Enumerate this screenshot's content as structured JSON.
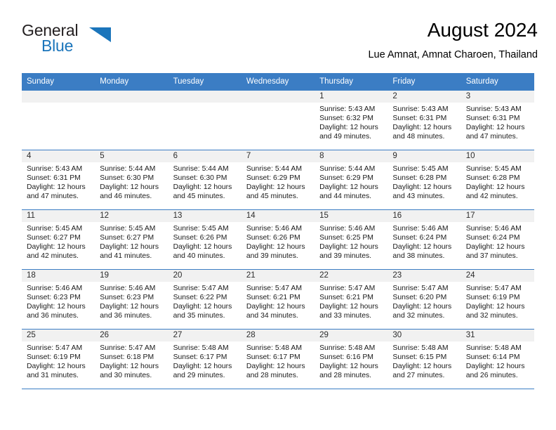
{
  "brand": {
    "word1": "General",
    "word2": "Blue",
    "triangle_color": "#1b75bb",
    "logo_icon": "triangle-flag-icon"
  },
  "header": {
    "title": "August 2024",
    "subtitle": "Lue Amnat, Amnat Charoen, Thailand"
  },
  "theme": {
    "header_blue": "#3b7dc4",
    "daynum_band": "#f1f1f1",
    "text": "#1a1a1a"
  },
  "weekdays": [
    "Sunday",
    "Monday",
    "Tuesday",
    "Wednesday",
    "Thursday",
    "Friday",
    "Saturday"
  ],
  "labels": {
    "sunrise_prefix": "Sunrise: ",
    "sunset_prefix": "Sunset: ",
    "daylight_prefix": "Daylight: "
  },
  "weeks": [
    [
      {
        "day": "",
        "empty": true
      },
      {
        "day": "",
        "empty": true
      },
      {
        "day": "",
        "empty": true
      },
      {
        "day": "",
        "empty": true
      },
      {
        "day": "1",
        "sunrise": "Sunrise: 5:43 AM",
        "sunset": "Sunset: 6:32 PM",
        "daylight1": "Daylight: 12 hours",
        "daylight2": "and 49 minutes."
      },
      {
        "day": "2",
        "sunrise": "Sunrise: 5:43 AM",
        "sunset": "Sunset: 6:31 PM",
        "daylight1": "Daylight: 12 hours",
        "daylight2": "and 48 minutes."
      },
      {
        "day": "3",
        "sunrise": "Sunrise: 5:43 AM",
        "sunset": "Sunset: 6:31 PM",
        "daylight1": "Daylight: 12 hours",
        "daylight2": "and 47 minutes."
      }
    ],
    [
      {
        "day": "4",
        "sunrise": "Sunrise: 5:43 AM",
        "sunset": "Sunset: 6:31 PM",
        "daylight1": "Daylight: 12 hours",
        "daylight2": "and 47 minutes."
      },
      {
        "day": "5",
        "sunrise": "Sunrise: 5:44 AM",
        "sunset": "Sunset: 6:30 PM",
        "daylight1": "Daylight: 12 hours",
        "daylight2": "and 46 minutes."
      },
      {
        "day": "6",
        "sunrise": "Sunrise: 5:44 AM",
        "sunset": "Sunset: 6:30 PM",
        "daylight1": "Daylight: 12 hours",
        "daylight2": "and 45 minutes."
      },
      {
        "day": "7",
        "sunrise": "Sunrise: 5:44 AM",
        "sunset": "Sunset: 6:29 PM",
        "daylight1": "Daylight: 12 hours",
        "daylight2": "and 45 minutes."
      },
      {
        "day": "8",
        "sunrise": "Sunrise: 5:44 AM",
        "sunset": "Sunset: 6:29 PM",
        "daylight1": "Daylight: 12 hours",
        "daylight2": "and 44 minutes."
      },
      {
        "day": "9",
        "sunrise": "Sunrise: 5:45 AM",
        "sunset": "Sunset: 6:28 PM",
        "daylight1": "Daylight: 12 hours",
        "daylight2": "and 43 minutes."
      },
      {
        "day": "10",
        "sunrise": "Sunrise: 5:45 AM",
        "sunset": "Sunset: 6:28 PM",
        "daylight1": "Daylight: 12 hours",
        "daylight2": "and 42 minutes."
      }
    ],
    [
      {
        "day": "11",
        "sunrise": "Sunrise: 5:45 AM",
        "sunset": "Sunset: 6:27 PM",
        "daylight1": "Daylight: 12 hours",
        "daylight2": "and 42 minutes."
      },
      {
        "day": "12",
        "sunrise": "Sunrise: 5:45 AM",
        "sunset": "Sunset: 6:27 PM",
        "daylight1": "Daylight: 12 hours",
        "daylight2": "and 41 minutes."
      },
      {
        "day": "13",
        "sunrise": "Sunrise: 5:45 AM",
        "sunset": "Sunset: 6:26 PM",
        "daylight1": "Daylight: 12 hours",
        "daylight2": "and 40 minutes."
      },
      {
        "day": "14",
        "sunrise": "Sunrise: 5:46 AM",
        "sunset": "Sunset: 6:26 PM",
        "daylight1": "Daylight: 12 hours",
        "daylight2": "and 39 minutes."
      },
      {
        "day": "15",
        "sunrise": "Sunrise: 5:46 AM",
        "sunset": "Sunset: 6:25 PM",
        "daylight1": "Daylight: 12 hours",
        "daylight2": "and 39 minutes."
      },
      {
        "day": "16",
        "sunrise": "Sunrise: 5:46 AM",
        "sunset": "Sunset: 6:24 PM",
        "daylight1": "Daylight: 12 hours",
        "daylight2": "and 38 minutes."
      },
      {
        "day": "17",
        "sunrise": "Sunrise: 5:46 AM",
        "sunset": "Sunset: 6:24 PM",
        "daylight1": "Daylight: 12 hours",
        "daylight2": "and 37 minutes."
      }
    ],
    [
      {
        "day": "18",
        "sunrise": "Sunrise: 5:46 AM",
        "sunset": "Sunset: 6:23 PM",
        "daylight1": "Daylight: 12 hours",
        "daylight2": "and 36 minutes."
      },
      {
        "day": "19",
        "sunrise": "Sunrise: 5:46 AM",
        "sunset": "Sunset: 6:23 PM",
        "daylight1": "Daylight: 12 hours",
        "daylight2": "and 36 minutes."
      },
      {
        "day": "20",
        "sunrise": "Sunrise: 5:47 AM",
        "sunset": "Sunset: 6:22 PM",
        "daylight1": "Daylight: 12 hours",
        "daylight2": "and 35 minutes."
      },
      {
        "day": "21",
        "sunrise": "Sunrise: 5:47 AM",
        "sunset": "Sunset: 6:21 PM",
        "daylight1": "Daylight: 12 hours",
        "daylight2": "and 34 minutes."
      },
      {
        "day": "22",
        "sunrise": "Sunrise: 5:47 AM",
        "sunset": "Sunset: 6:21 PM",
        "daylight1": "Daylight: 12 hours",
        "daylight2": "and 33 minutes."
      },
      {
        "day": "23",
        "sunrise": "Sunrise: 5:47 AM",
        "sunset": "Sunset: 6:20 PM",
        "daylight1": "Daylight: 12 hours",
        "daylight2": "and 32 minutes."
      },
      {
        "day": "24",
        "sunrise": "Sunrise: 5:47 AM",
        "sunset": "Sunset: 6:19 PM",
        "daylight1": "Daylight: 12 hours",
        "daylight2": "and 32 minutes."
      }
    ],
    [
      {
        "day": "25",
        "sunrise": "Sunrise: 5:47 AM",
        "sunset": "Sunset: 6:19 PM",
        "daylight1": "Daylight: 12 hours",
        "daylight2": "and 31 minutes."
      },
      {
        "day": "26",
        "sunrise": "Sunrise: 5:47 AM",
        "sunset": "Sunset: 6:18 PM",
        "daylight1": "Daylight: 12 hours",
        "daylight2": "and 30 minutes."
      },
      {
        "day": "27",
        "sunrise": "Sunrise: 5:48 AM",
        "sunset": "Sunset: 6:17 PM",
        "daylight1": "Daylight: 12 hours",
        "daylight2": "and 29 minutes."
      },
      {
        "day": "28",
        "sunrise": "Sunrise: 5:48 AM",
        "sunset": "Sunset: 6:17 PM",
        "daylight1": "Daylight: 12 hours",
        "daylight2": "and 28 minutes."
      },
      {
        "day": "29",
        "sunrise": "Sunrise: 5:48 AM",
        "sunset": "Sunset: 6:16 PM",
        "daylight1": "Daylight: 12 hours",
        "daylight2": "and 28 minutes."
      },
      {
        "day": "30",
        "sunrise": "Sunrise: 5:48 AM",
        "sunset": "Sunset: 6:15 PM",
        "daylight1": "Daylight: 12 hours",
        "daylight2": "and 27 minutes."
      },
      {
        "day": "31",
        "sunrise": "Sunrise: 5:48 AM",
        "sunset": "Sunset: 6:14 PM",
        "daylight1": "Daylight: 12 hours",
        "daylight2": "and 26 minutes."
      }
    ]
  ]
}
